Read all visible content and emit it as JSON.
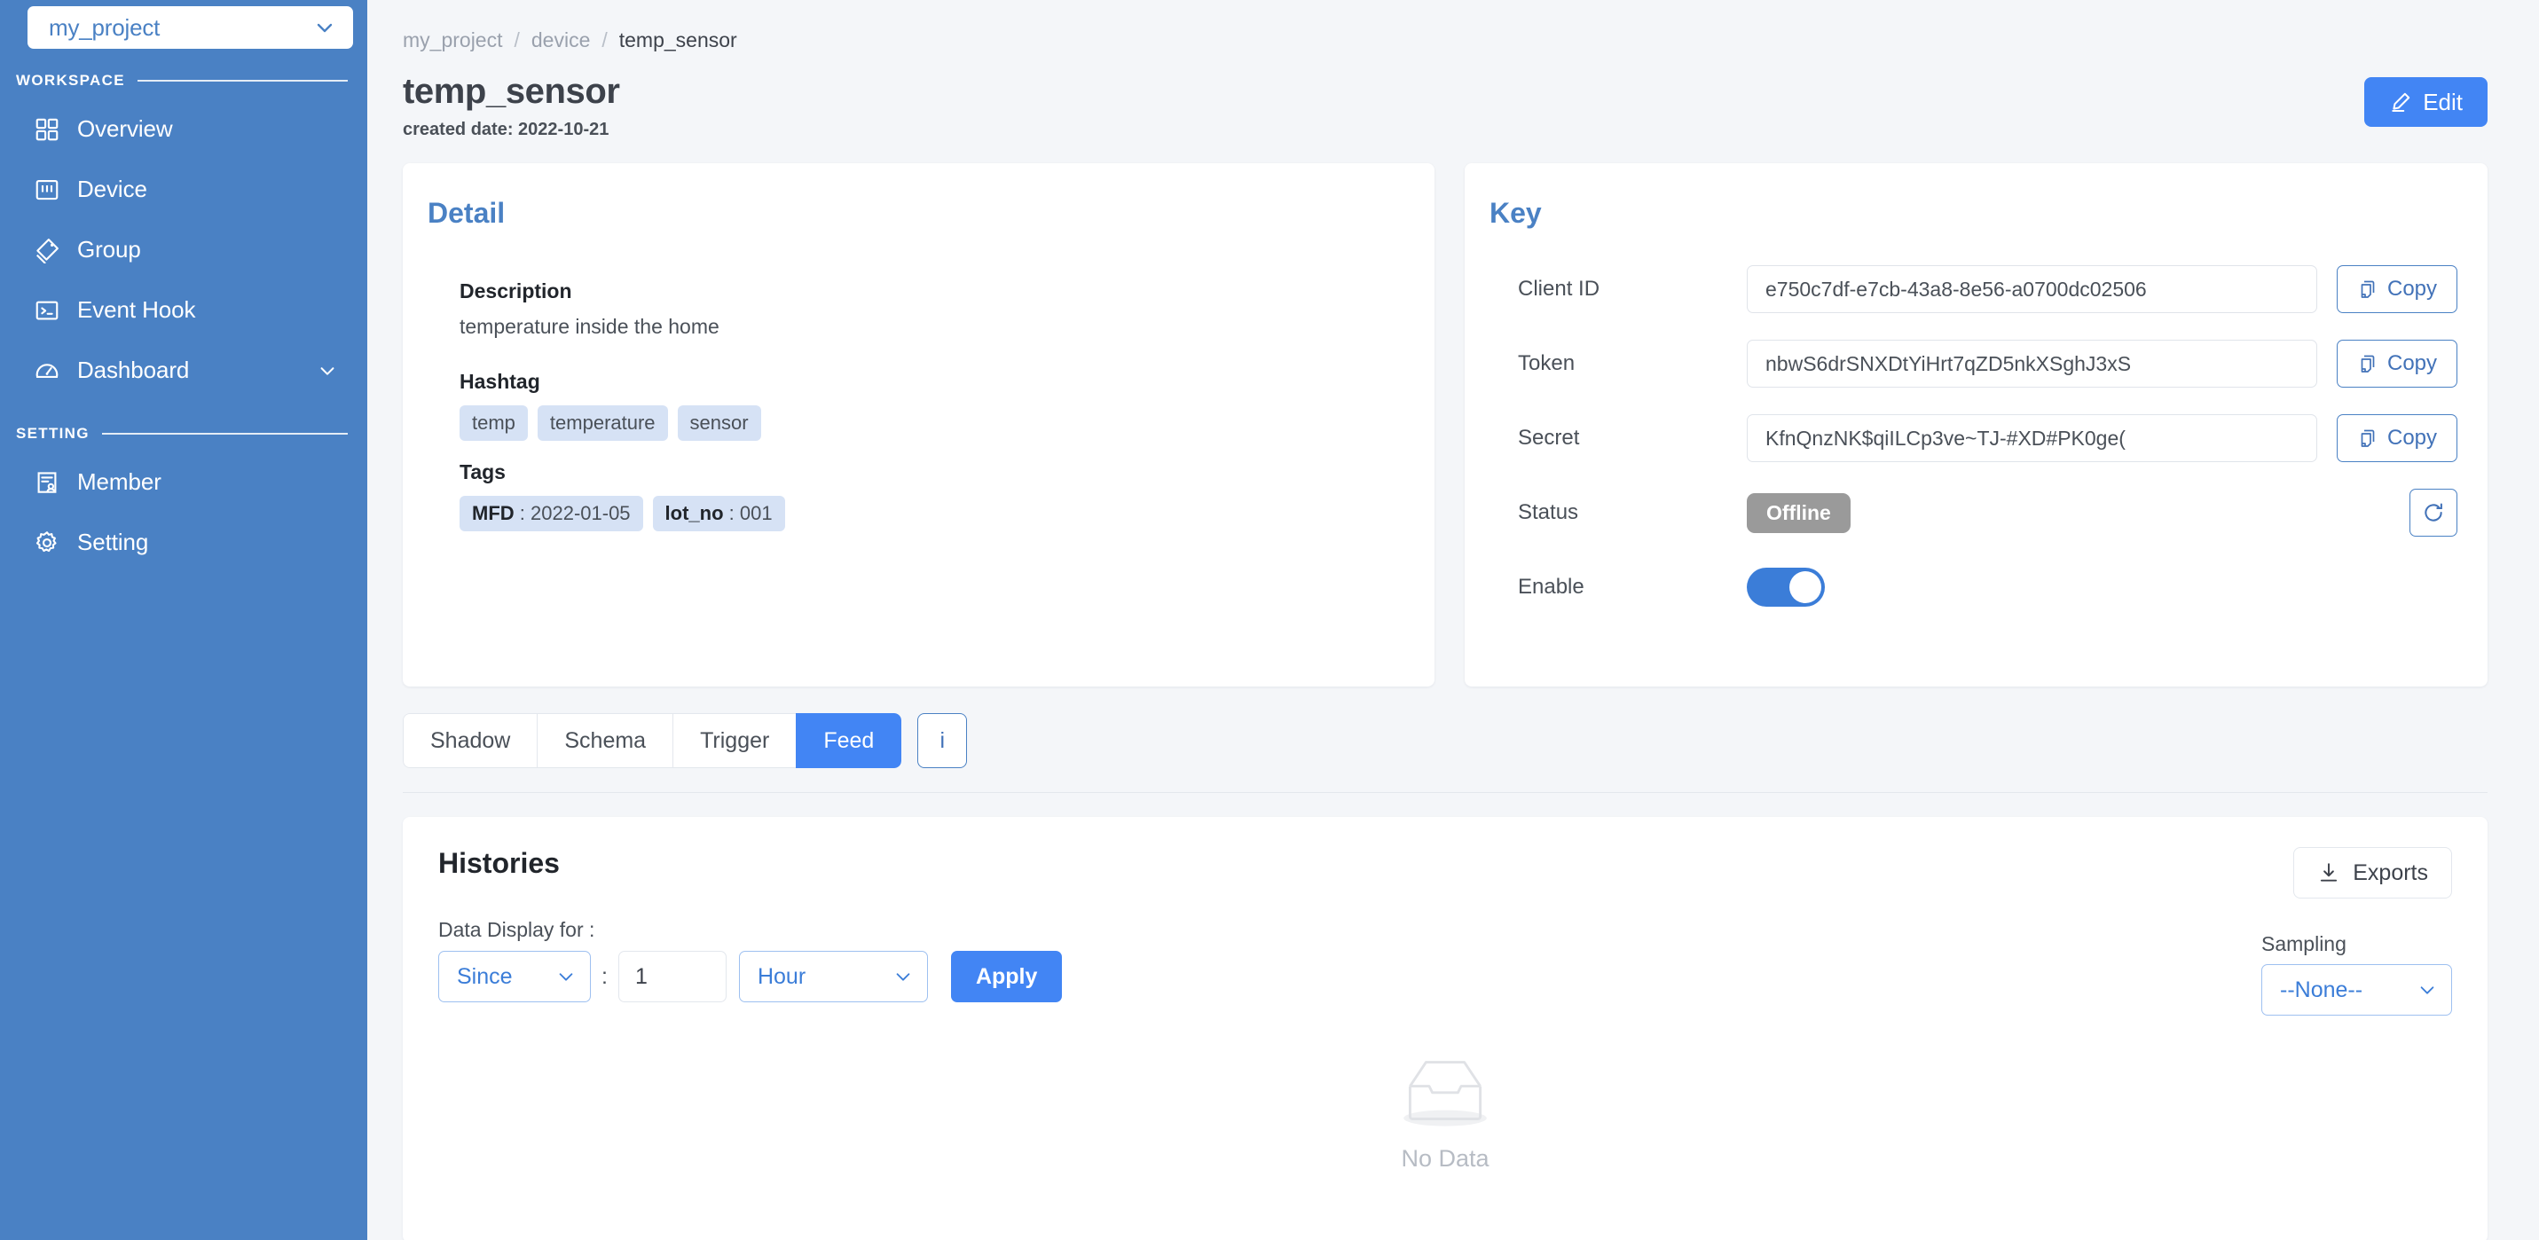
{
  "sidebar": {
    "project": {
      "name": "my_project",
      "icon": "chevron-down-icon"
    },
    "sections": [
      {
        "label": "WORKSPACE",
        "items": [
          {
            "label": "Overview",
            "icon": "grid-icon"
          },
          {
            "label": "Device",
            "icon": "device-icon"
          },
          {
            "label": "Group",
            "icon": "tag-icon"
          },
          {
            "label": "Event Hook",
            "icon": "terminal-icon"
          },
          {
            "label": "Dashboard",
            "icon": "gauge-icon",
            "caret": "chevron-down-icon"
          }
        ]
      },
      {
        "label": "SETTING",
        "items": [
          {
            "label": "Member",
            "icon": "member-icon"
          },
          {
            "label": "Setting",
            "icon": "gear-icon"
          }
        ]
      }
    ]
  },
  "breadcrumb": {
    "items": [
      "my_project",
      "device",
      "temp_sensor"
    ],
    "separator": "/"
  },
  "header": {
    "title": "temp_sensor",
    "created": "created date: 2022-10-21",
    "edit_label": "Edit",
    "edit_icon": "pencil-icon"
  },
  "detail": {
    "heading": "Detail",
    "description_label": "Description",
    "description_value": "temperature inside the home",
    "hashtag_label": "Hashtag",
    "hashtags": [
      "temp",
      "temperature",
      "sensor"
    ],
    "tags_label": "Tags",
    "tags": [
      {
        "key": "MFD",
        "value": "2022-01-05"
      },
      {
        "key": "lot_no",
        "value": "001"
      }
    ]
  },
  "key": {
    "heading": "Key",
    "rows": [
      {
        "label": "Client ID",
        "value": "e750c7df-e7cb-43a8-8e56-a0700dc02506",
        "action": "Copy",
        "icon": "copy-icon"
      },
      {
        "label": "Token",
        "value": "nbwS6drSNXDtYiHrt7qZD5nkXSghJ3xS",
        "action": "Copy",
        "icon": "copy-icon"
      },
      {
        "label": "Secret",
        "value": "KfnQnzNK$qiILCp3ve~TJ-#XD#PK0ge(",
        "action": "Copy",
        "icon": "copy-icon"
      }
    ],
    "status_label": "Status",
    "status_value": "Offline",
    "status_color": "#9a9a9a",
    "refresh_icon": "refresh-icon",
    "enable_label": "Enable",
    "enable_on": true
  },
  "tabs": {
    "items": [
      {
        "label": "Shadow",
        "active": false
      },
      {
        "label": "Schema",
        "active": false
      },
      {
        "label": "Trigger",
        "active": false
      },
      {
        "label": "Feed",
        "active": true
      }
    ],
    "info_label": "i"
  },
  "histories": {
    "heading": "Histories",
    "exports_label": "Exports",
    "exports_icon": "download-icon",
    "control_label": "Data Display for :",
    "mode_value": "Since",
    "colon": ":",
    "amount_value": "1",
    "unit_value": "Hour",
    "apply_label": "Apply",
    "sampling_label": "Sampling",
    "sampling_value": "--None--",
    "empty_text": "No Data",
    "empty_icon": "empty-box-icon"
  },
  "colors": {
    "sidebar": "#4a81c4",
    "accent": "#4285f4",
    "page_bg": "#f4f6f9",
    "heading_blue": "#4a81c4",
    "chip_bg": "#d6e2f5",
    "offline_gray": "#9a9a9a"
  }
}
